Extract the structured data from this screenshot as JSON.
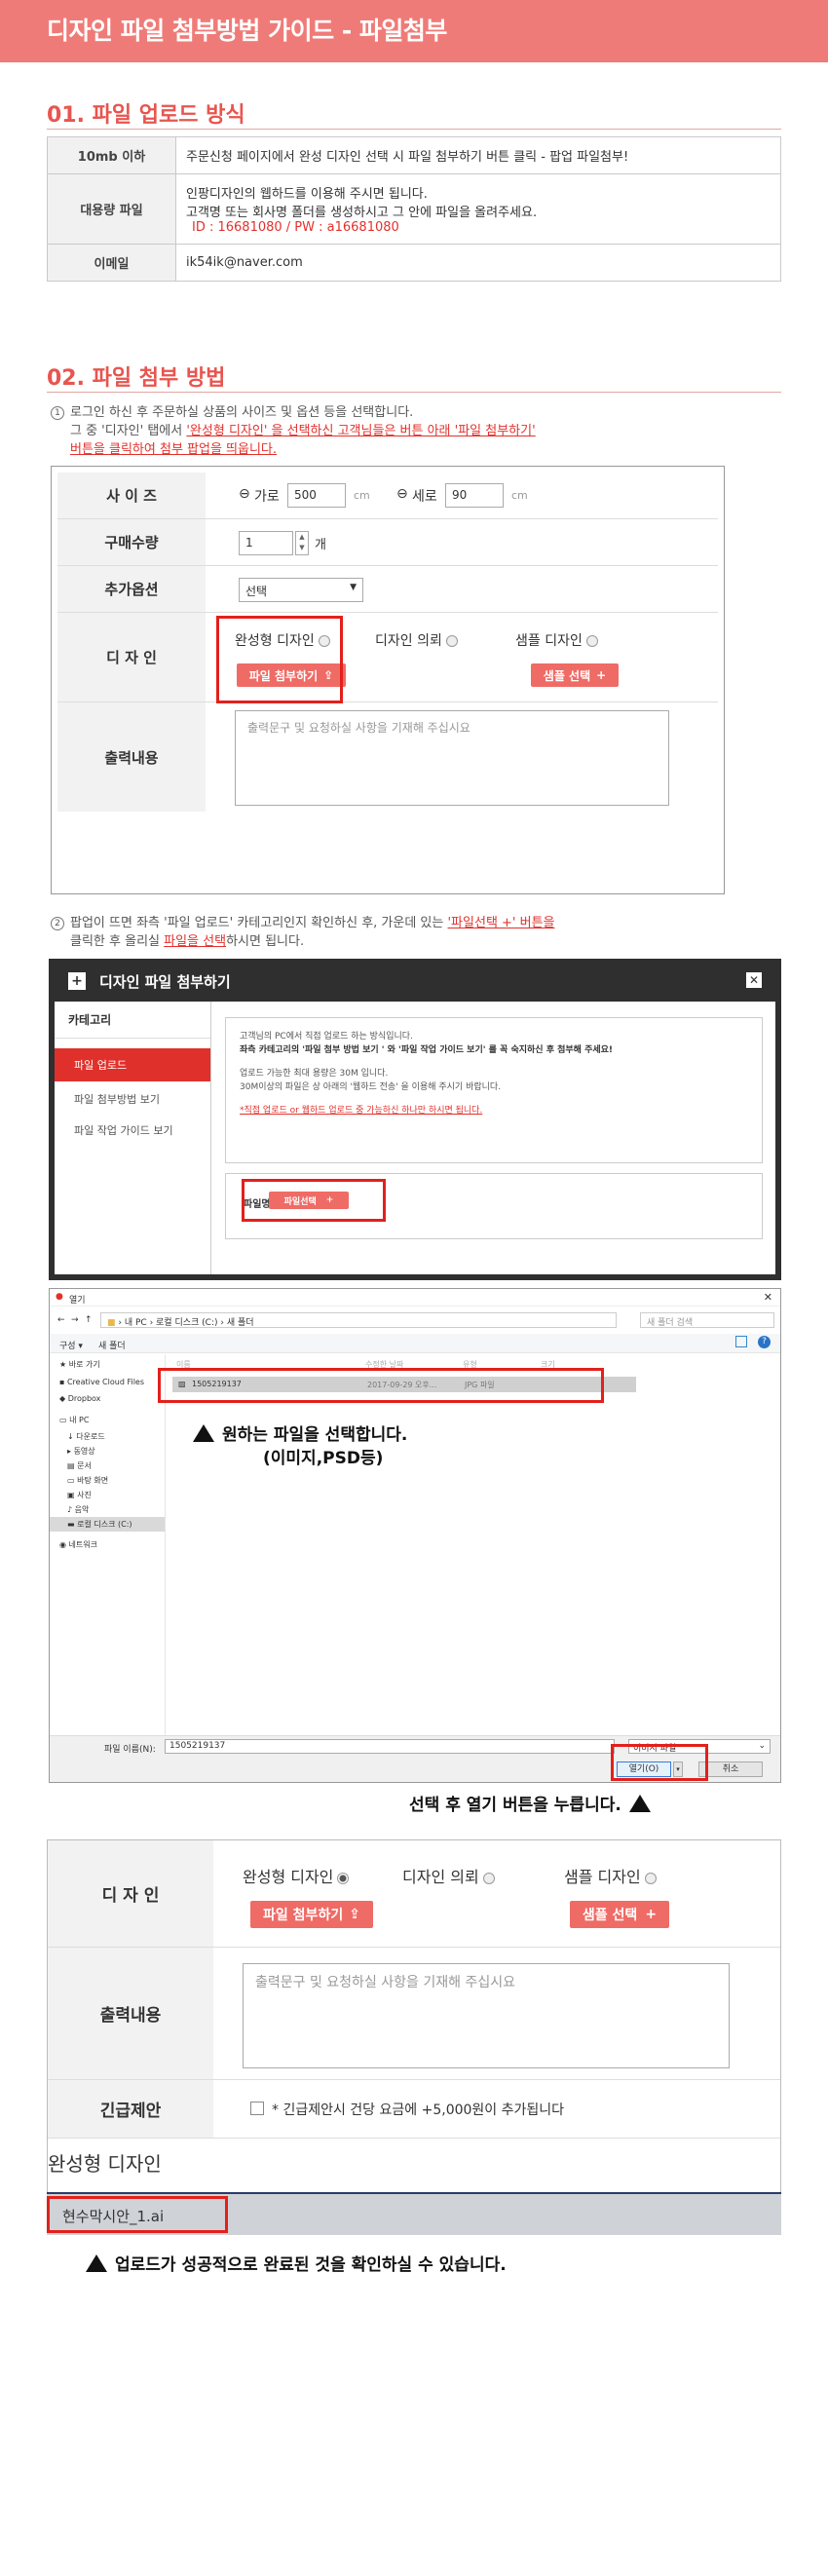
{
  "header": {
    "title": "디자인 파일 첨부방법 가이드 - 파일첨부"
  },
  "section1": {
    "title": "01. 파일 업로드 방식",
    "rows": [
      {
        "key": "10mb 이하",
        "lines": [
          "주문신청 페이지에서 완성 디자인 선택 시 파일 첨부하기 버튼 클릭 - 팝업 파일첨부!"
        ]
      },
      {
        "key": "대용량 파일",
        "lines": [
          "인팡디자인의 웹하드를 이용해 주시면 됩니다.",
          "고객명 또는 회사명 폴더를 생성하시고 그 안에 파일을 올려주세요."
        ],
        "cred": "ID : 16681080 / PW : a16681080"
      },
      {
        "key": "이메일",
        "lines": [
          "ik54ik@naver.com"
        ]
      }
    ]
  },
  "section2": {
    "title": "02. 파일 첨부 방법",
    "step1": {
      "num": "1",
      "line1": "로그인 하신 후 주문하실 상품의 사이즈 및 옵션 등을 선택합니다.",
      "line2a": "그 중 '디자인' 탭에서 ",
      "line2b": "'완성형 디자인' 을 선택하신 고객님들은  버튼 아래 '파일 첨부하기'",
      "line3": "버튼을 클릭하여 첨부 팝업을 띄웁니다."
    },
    "step2": {
      "num": "2",
      "line1a": "팝업이 뜨면 좌측 '파일 업로드' 카테고리인지 확인하신 후, 가운데 있는 ",
      "line1b": "'파일선택 +' 버튼을",
      "line2a": "클릭한 후 올리실 ",
      "line2b": "파일을 선택",
      "line2c": "하시면 됩니다."
    }
  },
  "form1": {
    "size_label": "사 이 즈",
    "w_label": "가로",
    "w_value": "500",
    "unit": "cm",
    "h_label": "세로",
    "h_value": "90",
    "qty_label": "구매수량",
    "qty_value": "1",
    "qty_unit": "개",
    "opt_label": "추가옵션",
    "opt_value": "선택",
    "design_label": "디 자 인",
    "d1": "완성형 디자인",
    "d2": "디자인 의뢰",
    "d3": "샘플 디자인",
    "attach_btn": "파일 첨부하기",
    "sample_btn": "샘플 선택",
    "output_label": "출력내용",
    "output_placeholder": "출력문구 및 요청하실 사항을 기재해 주십시요"
  },
  "popup": {
    "title": "디자인 파일 첨부하기",
    "menu_title": "카테고리",
    "menu": [
      "파일 업로드",
      "파일 첨부방법 보기",
      "파일 작업 가이드 보기"
    ],
    "info": [
      "고객님의 PC에서 직접 업로드 하는 방식입니다.",
      "좌측 카테고리의 '파일 첨부 방법 보기 ' 와 '파일 작업 가이드 보기' 를 꼭 숙지하신 후 첨부해 주세요!",
      "업로드 가능한 최대 용량은 30M 입니다.",
      "30M이상의 파일은 상 아래의 '웹하드 전송' 을 이용해 주시기 바랍니다.",
      "*직접 업로드 or 웹하드 업로드 중 가능하신 하나만 하시면 됩니다."
    ],
    "file_label": "파일명",
    "select_btn": "파일선택"
  },
  "dialog": {
    "title": "열기",
    "path": [
      "내 PC",
      "로컬 디스크 (C:)",
      "새 폴더"
    ],
    "search_placeholder": "새 폴더 검색",
    "organize": "구성 ▾",
    "new_folder": "새 폴더",
    "nav": [
      "바로 가기",
      "Creative Cloud Files",
      "Dropbox",
      "내 PC",
      "다운로드",
      "동영상",
      "문서",
      "바탕 화면",
      "사진",
      "음악",
      "로컬 디스크 (C:)",
      "네트워크"
    ],
    "cols": [
      "이름",
      "수정한 날짜",
      "유형",
      "크기"
    ],
    "file": {
      "name": "1505219137",
      "date": "2017-09-29 오후...",
      "type": "JPG 파일"
    },
    "filename_label": "파일 이름(N):",
    "filename_value": "1505219137",
    "filter": "이미지 파일",
    "open_btn": "열기(O)",
    "cancel_btn": "취소"
  },
  "captions": {
    "c1a": "원하는 파일을 선택합니다.",
    "c1b": "(이미지,PSD등)",
    "c2": "선택 후 열기 버튼을 누릅니다.",
    "c3": "업로드가 성공적으로 완료된 것을 확인하실 수 있습니다."
  },
  "form2": {
    "design_label": "디 자 인",
    "d1": "완성형 디자인",
    "d2": "디자인 의뢰",
    "d3": "샘플 디자인",
    "attach_btn": "파일 첨부하기",
    "sample_btn": "샘플 선택",
    "output_label": "출력내용",
    "output_placeholder": "출력문구 및 요청하실 사항을 기재해 주십시요",
    "urgent_label": "긴급제안",
    "urgent_text": "* 긴급제안시 건당 요금에 +5,000원이 추가됩니다",
    "section": "완성형 디자인",
    "uploaded": "현수막시안_1.ai"
  }
}
